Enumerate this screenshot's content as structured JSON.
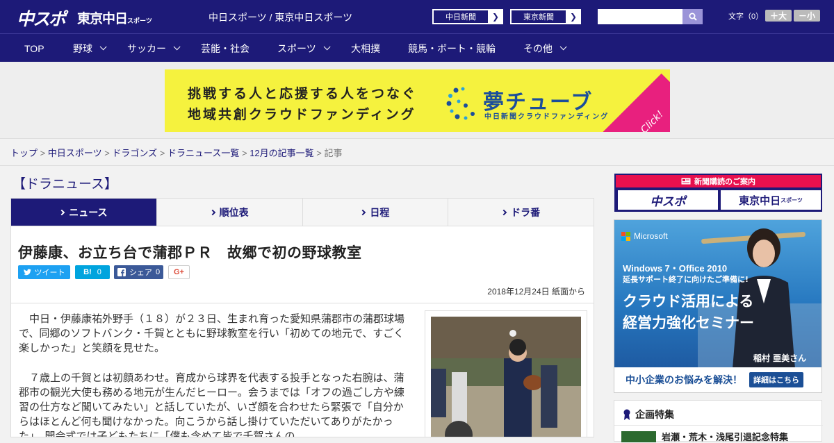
{
  "header": {
    "logo_main": "中スポ",
    "logo_sub": "東京中日",
    "logo_sub_small": "スポーツ",
    "site_name": "中日スポーツ / 東京中日スポーツ",
    "link1": "中日新聞",
    "link2": "東京新聞",
    "font_label": "文字（0）",
    "font_up": "＋大",
    "font_down": "－小"
  },
  "nav": {
    "items": [
      {
        "label": "TOP",
        "dropdown": false
      },
      {
        "label": "野球",
        "dropdown": true
      },
      {
        "label": "サッカー",
        "dropdown": true
      },
      {
        "label": "芸能・社会",
        "dropdown": false
      },
      {
        "label": "スポーツ",
        "dropdown": true
      },
      {
        "label": "大相撲",
        "dropdown": false
      },
      {
        "label": "競馬・ボート・競輪",
        "dropdown": false
      },
      {
        "label": "その他",
        "dropdown": true
      }
    ]
  },
  "banner": {
    "line1": "挑戦する人と応援する人をつなぐ",
    "line2": "地域共創クラウドファンディング",
    "title": "夢チューブ",
    "subtitle": "中日新聞クラウドファンディング",
    "click": "Click!"
  },
  "breadcrumb": {
    "items": [
      "トップ",
      "中日スポーツ",
      "ドラゴンズ",
      "ドラニュース一覧",
      "12月の記事一覧"
    ],
    "current": "記事",
    "sep": " > "
  },
  "section_title": "【ドラニュース】",
  "tabs": [
    {
      "label": "ニュース",
      "active": true
    },
    {
      "label": "順位表",
      "active": false
    },
    {
      "label": "日程",
      "active": false
    },
    {
      "label": "ドラ番",
      "active": false
    }
  ],
  "article": {
    "headline": "伊藤康、お立ち台で蒲郡ＰＲ　故郷で初の野球教室",
    "share": {
      "tweet": "ツイート",
      "hatena_label": "B!",
      "hatena_count": "0",
      "fb_label": "シェア",
      "fb_count": "0",
      "gplus": "G+"
    },
    "date": "2018年12月24日 紙面から",
    "paragraphs": [
      "中日・伊藤康祐外野手（１８）が２３日、生まれ育った愛知県蒲郡市の蒲郡球場で、同郷のソフトバンク・千賀とともに野球教室を行い「初めての地元で、すごく楽しかった」と笑顔を見せた。",
      "７歳上の千賀とは初顔あわせ。育成から球界を代表する投手となった右腕は、蒲郡市の観光大使も務める地元が生んだヒーロー。会うまでは「オフの過ごし方や練習の仕方など聞いてみたい」と話していたが、いざ顔を合わせたら緊張で「自分からはほとんど何も聞けなかった。向こうから話し掛けていただいてありがたかった」。開会式では子どもたちに「僕も含めて皆で千賀さんの"
    ]
  },
  "sidebar": {
    "sub_header": "新聞購読のご案内",
    "sub_btn1": "中スポ",
    "sub_btn2": "東京中日",
    "sub_btn2_small": "スポーツ",
    "ad": {
      "brand": "Microsoft",
      "line1": "Windows 7・Office 2010",
      "line2": "延長サポート終了に向けたご準備に!",
      "line3": "クラウド活用による",
      "line4": "経営力強化セミナー",
      "person": "稲村 亜美さん",
      "bottom": "中小企業のお悩みを解決！",
      "cta": "詳細はこちら"
    },
    "feature_title": "企画特集",
    "feature_item": "岩瀬・荒木・浅尾引退記念特集"
  },
  "colors": {
    "brand": "#1d1a78",
    "banner_bg": "#f5f23e",
    "twitter": "#1da1f2",
    "hatena": "#00a4de",
    "facebook": "#3b5998"
  }
}
